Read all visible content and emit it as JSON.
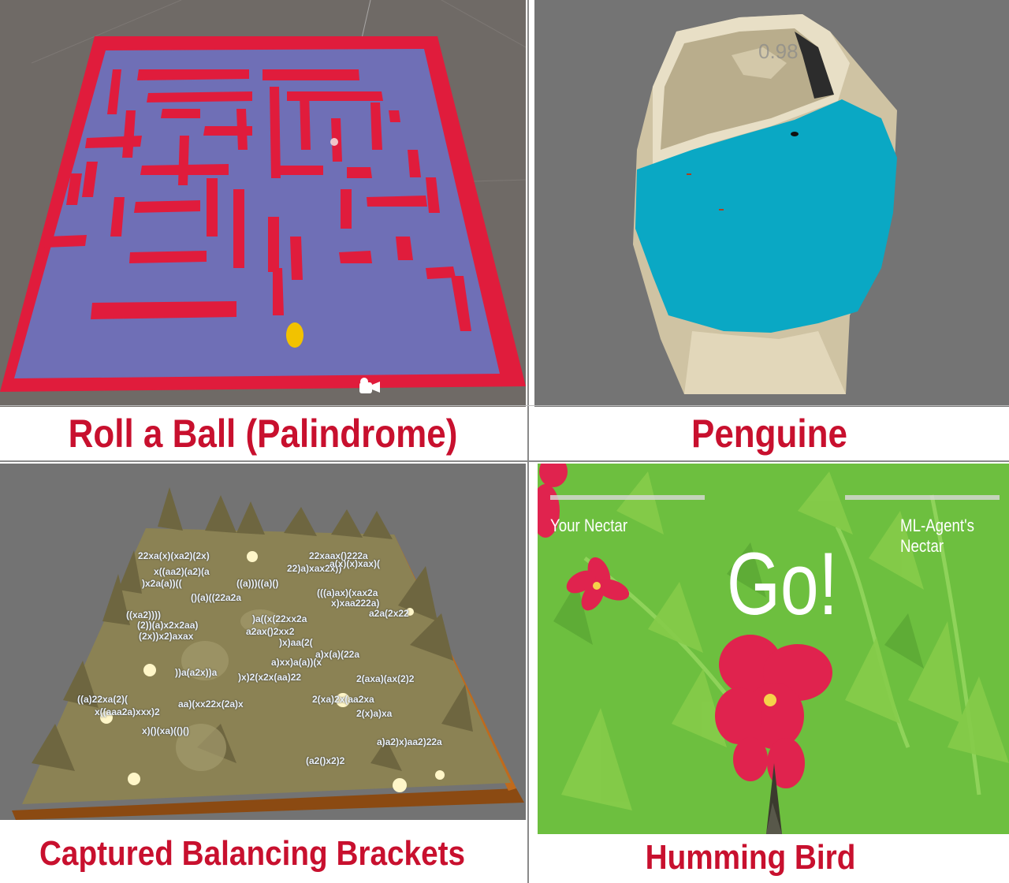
{
  "panels": {
    "roll_a_ball": {
      "caption": "Roll a Ball (Palindrome)"
    },
    "penguine": {
      "caption": "Penguine",
      "faint_counter": "0.98"
    },
    "brackets": {
      "caption": "Captured Balancing Brackets",
      "expressions": [
        "22xa(x)(xa2)(2x)",
        "x((aa2)(a2)(a",
        "22xaax()222a",
        "22)a)xax2x))",
        "a(x)(x)xax)(",
        ")x2a(a))((",
        "((a)))((a)()",
        "()(a)((22a2a",
        "(((a)ax)(xax2a",
        "x)xaa222a)",
        "a2a(2x22",
        "((xa2))))",
        "(2x))x2)axax",
        "(2))(a)x2x2aa)",
        ")a((x(22xx2a",
        "a2ax()2xx2",
        ")x)aa(2(",
        "a)x(a)(22a",
        "a)xx)a(a))(x",
        "))a(a2x))a",
        ")x)2(x2x(aa)22",
        "2(axa)(ax(2)2",
        "((a)22xa(2)(",
        "x((aaa2a)xxx)2",
        "aa)(xx22x(2a)x",
        "2(xa)2x(aa2xa",
        "2(x)a)xa",
        "x)()(xa)(()()",
        "a)a2)x)aa2)22a",
        "(a2()x2)2"
      ]
    },
    "humming_bird": {
      "caption": "Humming Bird",
      "your_nectar": "Your Nectar",
      "agent_nectar": "ML-Agent's Nectar",
      "banner": "Go!",
      "your_nectar_level": 0.0,
      "agent_nectar_level": 0.0
    }
  },
  "colors": {
    "caption_red": "#c8102e",
    "maze_floor": "#6f6fb6",
    "maze_wall": "#e01c3c",
    "ball": "#f2c200",
    "water": "#0aa8c4",
    "iceberg": "#d8ccaa",
    "editor_bg": "#747474",
    "terrain": "#8b8254",
    "grass": "#6dbf3f",
    "flower": "#e0234e"
  }
}
